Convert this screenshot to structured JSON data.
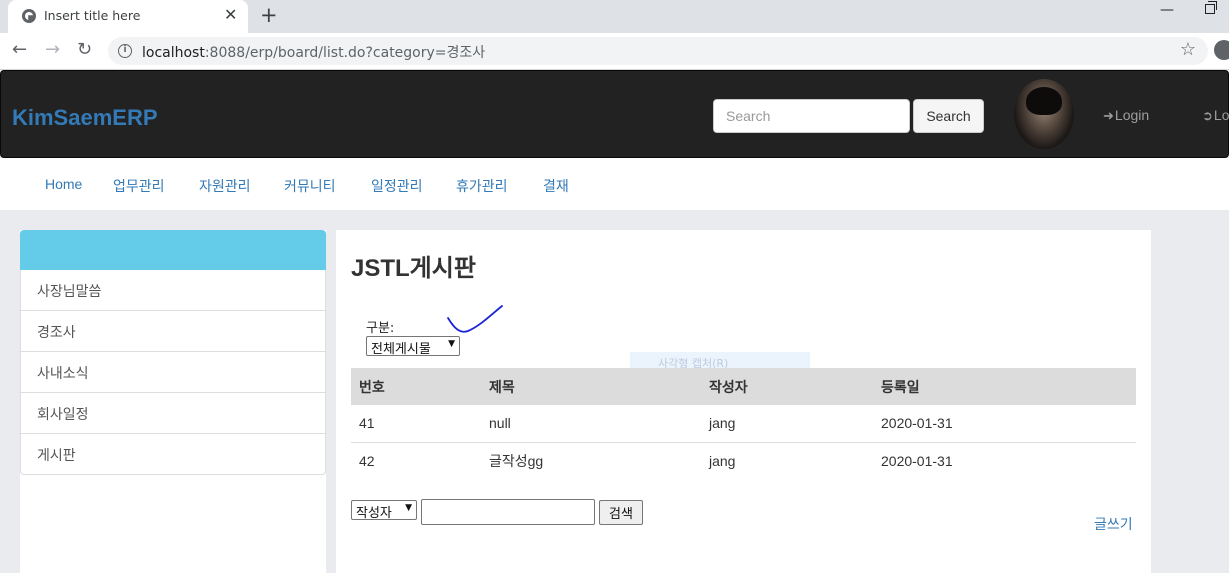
{
  "browser": {
    "tab_title": "Insert title here",
    "new_tab": "+",
    "tab_close": "✕",
    "url_host": "localhost",
    "url_rest": ":8088/erp/board/list.do?category=경조사"
  },
  "header": {
    "brand": "KimSaemERP",
    "search_placeholder": "Search",
    "search_button": "Search",
    "login": "Login",
    "logout": "Lo"
  },
  "menu": [
    "Home",
    "업무관리",
    "자원관리",
    "커뮤니티",
    "일정관리",
    "휴가관리",
    "결재"
  ],
  "sidebar": {
    "items": [
      "사장님말씀",
      "경조사",
      "사내소식",
      "회사일정",
      "게시판"
    ]
  },
  "board": {
    "title": "JSTL게시판",
    "category_label": "구분:",
    "category_selected": "전체게시물",
    "overlay_hint": "사각형 캡처(R)",
    "columns": [
      "번호",
      "제목",
      "작성자",
      "등록일"
    ],
    "rows": [
      [
        "41",
        "null",
        "jang",
        "2020-01-31"
      ],
      [
        "42",
        "글작성gg",
        "jang",
        "2020-01-31"
      ]
    ],
    "search_field_selected": "작성자",
    "search_button": "검색",
    "write_link": "글쓰기"
  },
  "colors": {
    "brand": "#337ab7",
    "navbar_bg": "#222222",
    "sidebar_header": "#64cbe8",
    "table_header": "#dcdcdc",
    "annotation_stroke": "#1a23d6"
  }
}
